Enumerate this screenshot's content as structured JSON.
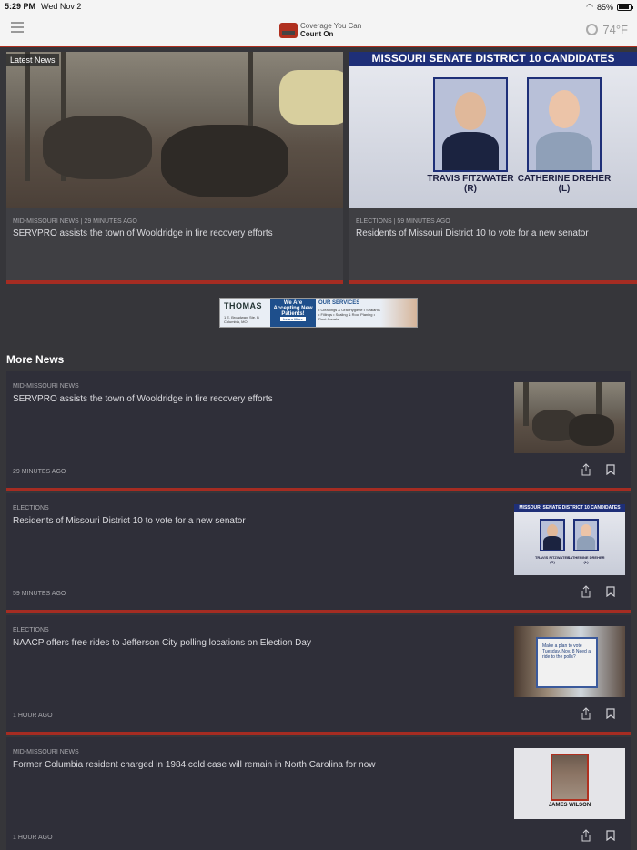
{
  "status": {
    "time": "5:29 PM",
    "date": "Wed Nov 2",
    "battery": "85%"
  },
  "header": {
    "logo_line1": "Coverage You Can",
    "logo_line2": "Count On",
    "temperature": "74°F"
  },
  "latest": {
    "badge": "Latest News",
    "cards": [
      {
        "meta": "MID-MISSOURI NEWS | 29 MINUTES AGO",
        "title": "SERVPRO assists the town of Wooldridge in fire recovery efforts"
      },
      {
        "meta": "ELECTIONS | 59 MINUTES AGO",
        "title": "Residents of Missouri District 10 to vote for a new senator",
        "graphic_banner": "MISSOURI SENATE DISTRICT 10 CANDIDATES",
        "cand1": "TRAVIS FITZWATER (R)",
        "cand2": "CATHERINE DREHER (L)"
      }
    ]
  },
  "ad": {
    "brand": "THOMAS",
    "address": "1 E. Broadway, Ste. B Columbia, MO",
    "accept": "We Are Accepting New Patients!",
    "cta": "Learn More",
    "services_title": "OUR SERVICES",
    "services": "• Cleanings & Oral Hygiene • Sealants • Fillings • Scaling & Root Planing • Root Canals"
  },
  "more": {
    "title": "More News",
    "items": [
      {
        "cat": "MID-MISSOURI NEWS",
        "headline": "SERVPRO assists the town of Wooldridge in fire recovery efforts",
        "age": "29 MINUTES AGO"
      },
      {
        "cat": "ELECTIONS",
        "headline": "Residents of Missouri District 10 to vote for a new senator",
        "age": "59 MINUTES AGO",
        "graphic_banner": "MISSOURI SENATE DISTRICT 10 CANDIDATES",
        "cand1": "TRAVIS FITZWATER (R)",
        "cand2": "CATHERINE DREHER (L)"
      },
      {
        "cat": "ELECTIONS",
        "headline": "NAACP offers free rides to Jefferson City polling locations on Election Day",
        "age": "1 HOUR AGO",
        "sign": "Make a plan to vote Tuesday, Nov. 8 Need a ride to the polls?"
      },
      {
        "cat": "MID-MISSOURI NEWS",
        "headline": "Former Columbia resident charged in 1984 cold case will remain in North Carolina for now",
        "age": "1 HOUR AGO",
        "mug_name": "JAMES WILSON"
      }
    ]
  }
}
